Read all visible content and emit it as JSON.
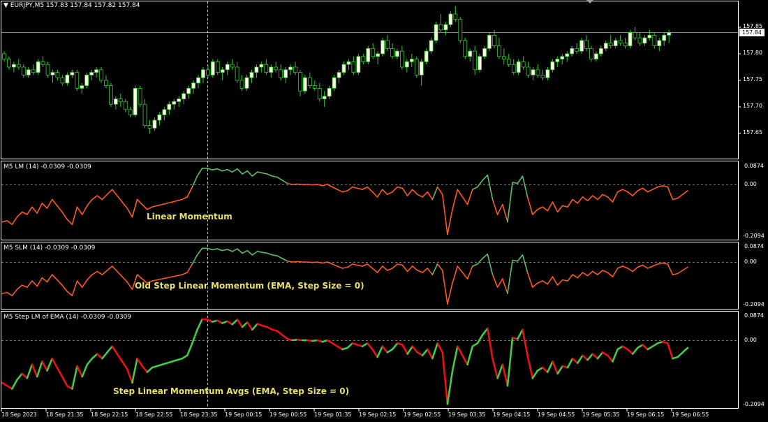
{
  "colors": {
    "background": "#000000",
    "frame": "#ffffff",
    "bull_candle": "#ffffe6",
    "bear_candle": "#000000",
    "wick": "#33cc33",
    "momentum_up": "#5fbf6a",
    "momentum_down": "#ff5a1f",
    "avgs_up": "#44cc44",
    "avgs_down": "#ee1111",
    "caption": "#e8e066"
  },
  "main": {
    "symbol_arrow": "▼",
    "symbol": "EURJPY,M5",
    "ohlc": "157.83 157.84 157.82 157.84",
    "price_ticks": [
      "157.85",
      "157.80",
      "157.75",
      "157.70",
      "157.65"
    ],
    "price_tick_values": [
      157.85,
      157.8,
      157.75,
      157.7,
      157.65
    ],
    "current_price": "157.84",
    "current_price_value": 157.84
  },
  "panes": [
    {
      "label": "M5 LM (14) -0.0309 -0.0309",
      "caption": "Linear Momentum",
      "top_tick": "0.0874",
      "mid_tick": "0.00",
      "bottom_tick": "-0.2094"
    },
    {
      "label": "M5 SLM (14) -0.0309 -0.0309",
      "caption": "Old Step Linear Momentum (EMA, Step Size = 0)",
      "top_tick": "0.0874",
      "mid_tick": "0.00",
      "bottom_tick": "-0.2094"
    },
    {
      "label": "M5 Step LM of EMA (14) -0.0309 -0.0309",
      "caption": "Step Linear Momentum Avgs (EMA, Step Size = 0)",
      "top_tick": "0.0874",
      "mid_tick": "0.00",
      "bottom_tick": "-0.2094"
    }
  ],
  "time_axis": [
    "18 Sep 2023",
    "18 Sep 21:35",
    "18 Sep 22:15",
    "18 Sep 22:55",
    "18 Sep 23:35",
    "19 Sep 00:15",
    "19 Sep 00:55",
    "19 Sep 01:35",
    "19 Sep 02:15",
    "19 Sep 02:55",
    "19 Sep 03:35",
    "19 Sep 04:15",
    "19 Sep 04:55",
    "19 Sep 05:35",
    "19 Sep 06:15",
    "19 Sep 06:55"
  ],
  "candles_ohlc": [
    [
      157.8,
      157.805,
      157.785,
      157.79
    ],
    [
      157.79,
      157.795,
      157.77,
      157.775
    ],
    [
      157.775,
      157.785,
      157.765,
      157.78
    ],
    [
      157.78,
      157.79,
      157.77,
      157.775
    ],
    [
      157.775,
      157.78,
      157.755,
      157.76
    ],
    [
      157.76,
      157.775,
      157.755,
      157.77
    ],
    [
      157.77,
      157.78,
      157.76,
      157.765
    ],
    [
      157.765,
      157.79,
      157.76,
      157.785
    ],
    [
      157.785,
      157.795,
      157.775,
      157.78
    ],
    [
      157.78,
      157.785,
      157.755,
      157.76
    ],
    [
      157.76,
      157.77,
      157.745,
      157.765
    ],
    [
      157.765,
      157.77,
      157.75,
      157.755
    ],
    [
      157.755,
      157.76,
      157.74,
      157.745
    ],
    [
      157.745,
      157.765,
      157.74,
      157.76
    ],
    [
      157.76,
      157.77,
      157.755,
      157.765
    ],
    [
      157.765,
      157.77,
      157.73,
      157.735
    ],
    [
      157.735,
      157.745,
      157.725,
      157.74
    ],
    [
      157.74,
      157.765,
      157.735,
      157.76
    ],
    [
      157.76,
      157.77,
      157.75,
      157.765
    ],
    [
      157.765,
      157.775,
      157.755,
      157.77
    ],
    [
      157.77,
      157.775,
      157.745,
      157.75
    ],
    [
      157.75,
      157.76,
      157.735,
      157.74
    ],
    [
      157.74,
      157.745,
      157.7,
      157.705
    ],
    [
      157.705,
      157.72,
      157.695,
      157.715
    ],
    [
      157.715,
      157.725,
      157.7,
      157.71
    ],
    [
      157.71,
      157.715,
      157.69,
      157.695
    ],
    [
      157.695,
      157.7,
      157.68,
      157.685
    ],
    [
      157.685,
      157.74,
      157.68,
      157.735
    ],
    [
      157.735,
      157.74,
      157.7,
      157.705
    ],
    [
      157.705,
      157.715,
      157.66,
      157.665
    ],
    [
      157.665,
      157.675,
      157.65,
      157.66
    ],
    [
      157.66,
      157.68,
      157.655,
      157.675
    ],
    [
      157.675,
      157.69,
      157.665,
      157.685
    ],
    [
      157.685,
      157.7,
      157.675,
      157.695
    ],
    [
      157.695,
      157.71,
      157.685,
      157.705
    ],
    [
      157.705,
      157.715,
      157.695,
      157.71
    ],
    [
      157.71,
      157.72,
      157.7,
      157.715
    ],
    [
      157.715,
      157.73,
      157.705,
      157.725
    ],
    [
      157.725,
      157.74,
      157.715,
      157.735
    ],
    [
      157.735,
      157.75,
      157.725,
      157.745
    ],
    [
      157.745,
      157.76,
      157.735,
      157.755
    ],
    [
      157.755,
      157.775,
      157.745,
      157.77
    ],
    [
      157.77,
      157.78,
      157.755,
      157.76
    ],
    [
      157.76,
      157.79,
      157.755,
      157.785
    ],
    [
      157.785,
      157.79,
      157.76,
      157.765
    ],
    [
      157.765,
      157.775,
      157.75,
      157.77
    ],
    [
      157.77,
      157.785,
      157.76,
      157.78
    ],
    [
      157.78,
      157.79,
      157.77,
      157.775
    ],
    [
      157.775,
      157.785,
      157.745,
      157.75
    ],
    [
      157.75,
      157.76,
      157.73,
      157.735
    ],
    [
      157.735,
      157.76,
      157.73,
      157.755
    ],
    [
      157.755,
      157.77,
      157.745,
      157.765
    ],
    [
      157.765,
      157.78,
      157.755,
      157.775
    ],
    [
      157.775,
      157.785,
      157.765,
      157.78
    ],
    [
      157.78,
      157.79,
      157.76,
      157.765
    ],
    [
      157.765,
      157.78,
      157.755,
      157.775
    ],
    [
      157.775,
      157.785,
      157.765,
      157.77
    ],
    [
      157.77,
      157.78,
      157.75,
      157.755
    ],
    [
      157.755,
      157.775,
      157.745,
      157.77
    ],
    [
      157.77,
      157.78,
      157.76,
      157.775
    ],
    [
      157.775,
      157.785,
      157.76,
      157.765
    ],
    [
      157.765,
      157.77,
      157.72,
      157.73
    ],
    [
      157.73,
      157.76,
      157.725,
      157.755
    ],
    [
      157.755,
      157.765,
      157.735,
      157.74
    ],
    [
      157.74,
      157.75,
      157.73,
      157.735
    ],
    [
      157.735,
      157.745,
      157.71,
      157.715
    ],
    [
      157.715,
      157.73,
      157.7,
      157.72
    ],
    [
      157.72,
      157.74,
      157.715,
      157.735
    ],
    [
      157.735,
      157.76,
      157.73,
      157.755
    ],
    [
      157.755,
      157.77,
      157.745,
      157.765
    ],
    [
      157.765,
      157.785,
      157.76,
      157.78
    ],
    [
      157.78,
      157.79,
      157.77,
      157.785
    ],
    [
      157.785,
      157.795,
      157.76,
      157.765
    ],
    [
      157.765,
      157.8,
      157.76,
      157.795
    ],
    [
      157.795,
      157.8,
      157.78,
      157.785
    ],
    [
      157.785,
      157.815,
      157.78,
      157.81
    ],
    [
      157.81,
      157.82,
      157.79,
      157.795
    ],
    [
      157.795,
      157.805,
      157.78,
      157.8
    ],
    [
      157.8,
      157.83,
      157.795,
      157.825
    ],
    [
      157.825,
      157.835,
      157.805,
      157.81
    ],
    [
      157.81,
      157.82,
      157.79,
      157.795
    ],
    [
      157.795,
      157.81,
      157.79,
      157.805
    ],
    [
      157.805,
      157.815,
      157.77,
      157.775
    ],
    [
      157.775,
      157.79,
      157.765,
      157.785
    ],
    [
      157.785,
      157.8,
      157.775,
      157.79
    ],
    [
      157.79,
      157.795,
      157.755,
      157.76
    ],
    [
      157.76,
      157.79,
      157.74,
      157.785
    ],
    [
      157.785,
      157.81,
      157.78,
      157.805
    ],
    [
      157.805,
      157.83,
      157.8,
      157.825
    ],
    [
      157.825,
      157.86,
      157.82,
      157.855
    ],
    [
      157.855,
      157.875,
      157.84,
      157.845
    ],
    [
      157.845,
      157.86,
      157.835,
      157.855
    ],
    [
      157.855,
      157.88,
      157.85,
      157.875
    ],
    [
      157.875,
      157.89,
      157.86,
      157.865
    ],
    [
      157.865,
      157.87,
      157.82,
      157.825
    ],
    [
      157.825,
      157.83,
      157.79,
      157.795
    ],
    [
      157.795,
      157.81,
      157.785,
      157.805
    ],
    [
      157.805,
      157.815,
      157.76,
      157.77
    ],
    [
      157.77,
      157.8,
      157.765,
      157.795
    ],
    [
      157.795,
      157.815,
      157.79,
      157.81
    ],
    [
      157.81,
      157.84,
      157.805,
      157.835
    ],
    [
      157.835,
      157.845,
      157.81,
      157.815
    ],
    [
      157.815,
      157.83,
      157.79,
      157.795
    ],
    [
      157.795,
      157.81,
      157.78,
      157.79
    ],
    [
      157.79,
      157.8,
      157.775,
      157.78
    ],
    [
      157.78,
      157.79,
      157.76,
      157.765
    ],
    [
      157.765,
      157.79,
      157.76,
      157.785
    ],
    [
      157.785,
      157.795,
      157.77,
      157.775
    ],
    [
      157.775,
      157.785,
      157.755,
      157.76
    ],
    [
      157.76,
      157.775,
      157.75,
      157.77
    ],
    [
      157.77,
      157.78,
      157.755,
      157.76
    ],
    [
      157.76,
      157.77,
      157.75,
      157.755
    ],
    [
      157.755,
      157.775,
      157.75,
      157.77
    ],
    [
      157.77,
      157.79,
      157.765,
      157.785
    ],
    [
      157.785,
      157.795,
      157.775,
      157.79
    ],
    [
      157.79,
      157.8,
      157.78,
      157.795
    ],
    [
      157.795,
      157.805,
      157.785,
      157.8
    ],
    [
      157.8,
      157.815,
      157.795,
      157.81
    ],
    [
      157.81,
      157.82,
      157.8,
      157.805
    ],
    [
      157.805,
      157.83,
      157.8,
      157.825
    ],
    [
      157.825,
      157.835,
      157.805,
      157.81
    ],
    [
      157.81,
      157.815,
      157.785,
      157.79
    ],
    [
      157.79,
      157.805,
      157.785,
      157.8
    ],
    [
      157.8,
      157.815,
      157.795,
      157.81
    ],
    [
      157.81,
      157.825,
      157.805,
      157.82
    ],
    [
      157.82,
      157.835,
      157.81,
      157.815
    ],
    [
      157.815,
      157.83,
      157.81,
      157.825
    ],
    [
      157.825,
      157.835,
      157.815,
      157.82
    ],
    [
      157.82,
      157.83,
      157.81,
      157.815
    ],
    [
      157.815,
      157.845,
      157.81,
      157.84
    ],
    [
      157.84,
      157.85,
      157.825,
      157.83
    ],
    [
      157.83,
      157.84,
      157.815,
      157.82
    ],
    [
      157.82,
      157.835,
      157.815,
      157.83
    ],
    [
      157.83,
      157.845,
      157.825,
      157.835
    ],
    [
      157.835,
      157.84,
      157.81,
      157.815
    ],
    [
      157.815,
      157.83,
      157.805,
      157.825
    ],
    [
      157.825,
      157.84,
      157.815,
      157.835
    ],
    [
      157.835,
      157.845,
      157.82,
      157.84
    ]
  ],
  "lm_values": [
    -0.15,
    -0.145,
    -0.16,
    -0.13,
    -0.11,
    -0.12,
    -0.09,
    -0.115,
    -0.075,
    -0.095,
    -0.06,
    -0.085,
    -0.11,
    -0.14,
    -0.16,
    -0.09,
    -0.12,
    -0.085,
    -0.06,
    -0.045,
    -0.06,
    -0.04,
    -0.02,
    -0.045,
    -0.07,
    -0.095,
    -0.13,
    -0.06,
    -0.08,
    -0.1,
    -0.09,
    -0.085,
    -0.08,
    -0.075,
    -0.07,
    -0.065,
    -0.06,
    -0.05,
    -0.01,
    0.04,
    0.078,
    0.078,
    0.07,
    0.075,
    0.065,
    0.072,
    0.06,
    0.075,
    0.05,
    0.065,
    0.04,
    0.06,
    0.055,
    0.05,
    0.04,
    0.035,
    0.02,
    0.005,
    0.0,
    0.002,
    0.0,
    0.0,
    -0.002,
    0.0,
    -0.005,
    0.0,
    -0.01,
    -0.02,
    -0.03,
    -0.025,
    -0.01,
    -0.015,
    -0.02,
    -0.01,
    -0.03,
    -0.05,
    -0.02,
    -0.04,
    -0.03,
    -0.01,
    -0.015,
    -0.045,
    -0.02,
    -0.04,
    -0.05,
    -0.03,
    -0.06,
    -0.01,
    -0.04,
    -0.2,
    -0.1,
    -0.02,
    -0.05,
    -0.08,
    -0.02,
    -0.01,
    0.02,
    0.045,
    -0.06,
    -0.12,
    -0.08,
    -0.15,
    0.01,
    0.005,
    0.04,
    -0.05,
    -0.12,
    -0.1,
    -0.09,
    -0.105,
    -0.07,
    -0.11,
    -0.085,
    -0.09,
    -0.06,
    -0.075,
    -0.05,
    -0.065,
    -0.045,
    -0.06,
    -0.04,
    -0.05,
    -0.07,
    -0.03,
    -0.02,
    -0.03,
    -0.045,
    -0.025,
    -0.015,
    -0.03,
    -0.02,
    -0.01,
    -0.005,
    -0.01,
    -0.06,
    -0.055,
    -0.04,
    -0.025
  ],
  "avgs_values": [
    -0.14,
    -0.15,
    -0.16,
    -0.13,
    -0.11,
    -0.125,
    -0.08,
    -0.12,
    -0.07,
    -0.1,
    -0.06,
    -0.09,
    -0.12,
    -0.15,
    -0.16,
    -0.085,
    -0.12,
    -0.08,
    -0.06,
    -0.045,
    -0.06,
    -0.04,
    -0.02,
    -0.045,
    -0.07,
    -0.095,
    -0.14,
    -0.06,
    -0.085,
    -0.105,
    -0.09,
    -0.085,
    -0.08,
    -0.075,
    -0.07,
    -0.065,
    -0.06,
    -0.05,
    -0.01,
    0.04,
    0.08,
    0.078,
    0.07,
    0.075,
    0.065,
    0.072,
    0.06,
    0.078,
    0.05,
    0.068,
    0.04,
    0.062,
    0.055,
    0.05,
    0.04,
    0.035,
    0.02,
    0.005,
    0.0,
    0.002,
    0.0,
    0.0,
    -0.002,
    0.0,
    -0.005,
    0.0,
    -0.01,
    -0.02,
    -0.03,
    -0.025,
    -0.01,
    -0.015,
    -0.02,
    -0.01,
    -0.03,
    -0.055,
    -0.02,
    -0.04,
    -0.03,
    -0.01,
    -0.015,
    -0.045,
    -0.02,
    -0.04,
    -0.05,
    -0.03,
    -0.06,
    -0.01,
    -0.04,
    -0.21,
    -0.1,
    -0.02,
    -0.05,
    -0.08,
    -0.02,
    -0.01,
    0.02,
    0.045,
    -0.06,
    -0.125,
    -0.08,
    -0.15,
    0.01,
    0.005,
    0.04,
    -0.05,
    -0.125,
    -0.1,
    -0.09,
    -0.105,
    -0.07,
    -0.11,
    -0.085,
    -0.09,
    -0.06,
    -0.075,
    -0.05,
    -0.065,
    -0.045,
    -0.06,
    -0.04,
    -0.05,
    -0.07,
    -0.03,
    -0.02,
    -0.03,
    -0.045,
    -0.025,
    -0.015,
    -0.03,
    -0.02,
    -0.01,
    -0.005,
    -0.01,
    -0.06,
    -0.055,
    -0.04,
    -0.025
  ]
}
